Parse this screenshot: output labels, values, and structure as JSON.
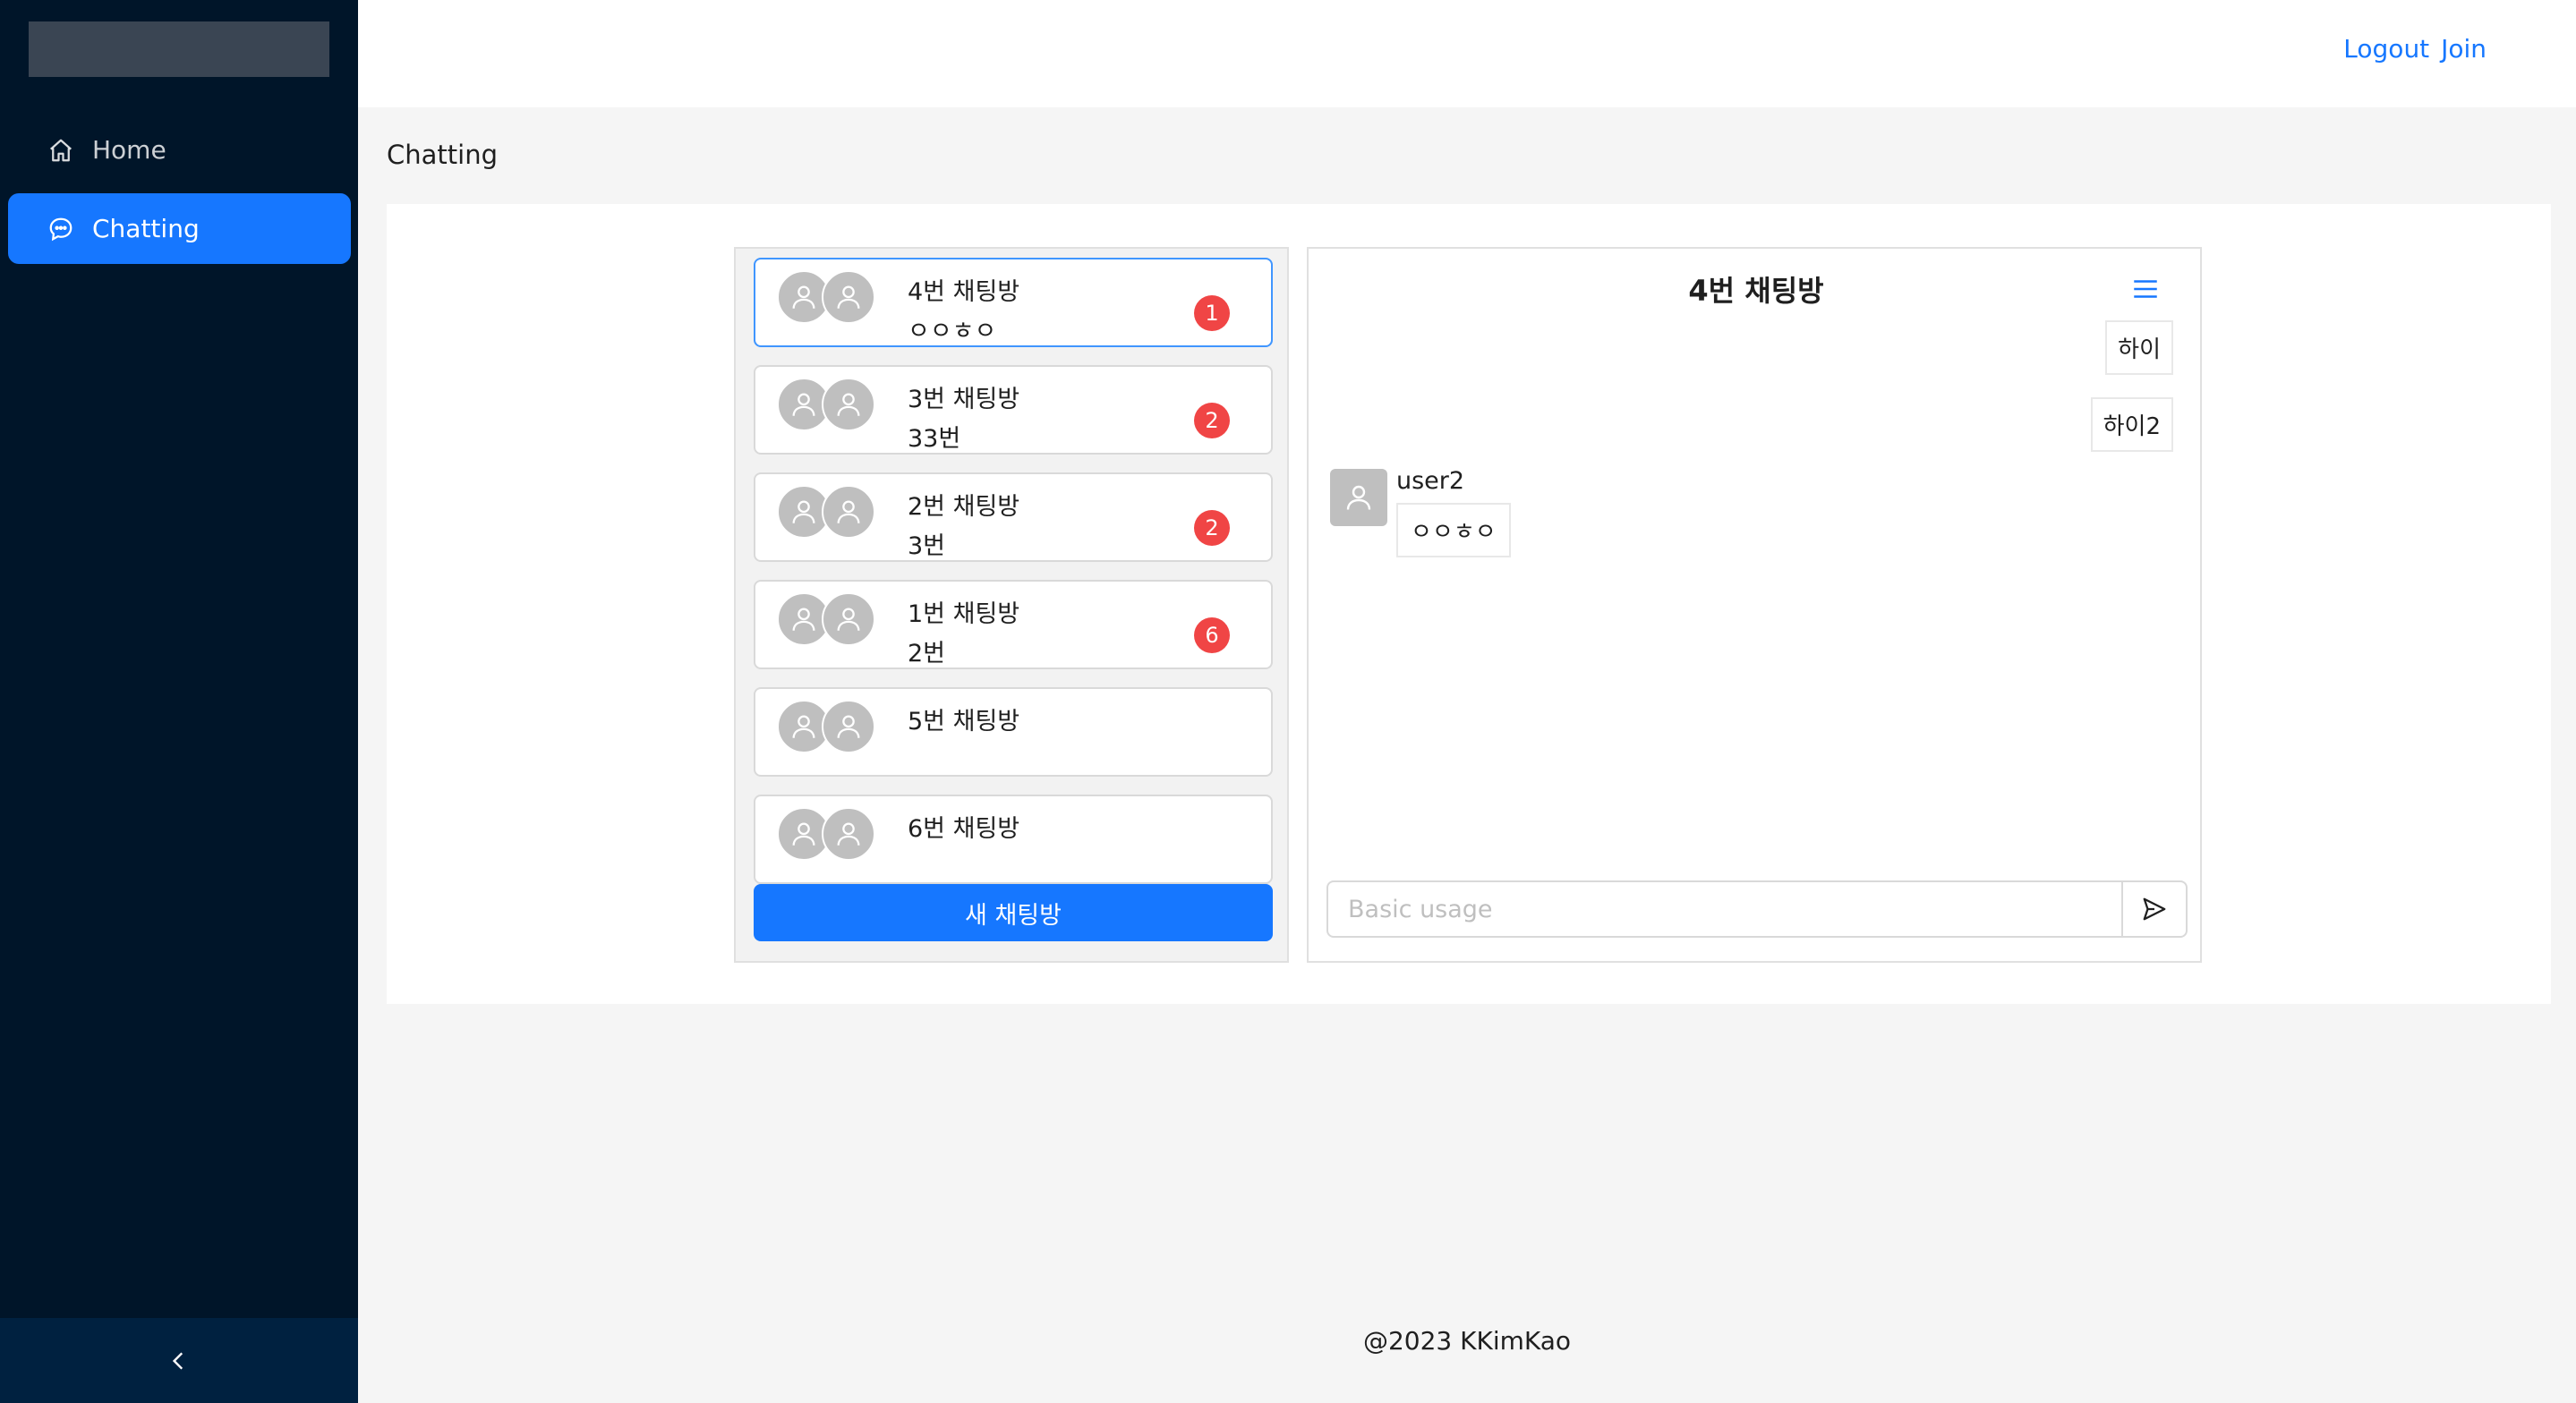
{
  "sidebar": {
    "items": [
      {
        "label": "Home",
        "icon": "home-icon"
      },
      {
        "label": "Chatting",
        "icon": "message-icon"
      }
    ],
    "collapse_icon": "chevron-left-icon"
  },
  "header": {
    "logout": "Logout",
    "join": "Join"
  },
  "breadcrumb": "Chatting",
  "rooms": [
    {
      "title": "4번 채팅방",
      "last": "ㅇㅇㅎㅇ",
      "unread": "1"
    },
    {
      "title": "3번 채팅방",
      "last": "33번",
      "unread": "2"
    },
    {
      "title": "2번 채팅방",
      "last": "3번",
      "unread": "2"
    },
    {
      "title": "1번 채팅방",
      "last": "2번",
      "unread": "6"
    },
    {
      "title": "5번 채팅방",
      "last": "",
      "unread": ""
    },
    {
      "title": "6번 채팅방",
      "last": "",
      "unread": ""
    }
  ],
  "new_room_label": "새 채팅방",
  "chat": {
    "title": "4번 채팅방",
    "my_messages": [
      "하이",
      "하이2"
    ],
    "other": {
      "user": "user2",
      "text": "ㅇㅇㅎㅇ"
    },
    "input_placeholder": "Basic usage"
  },
  "footer": "@2023 KKimKao",
  "colors": {
    "sidebar_bg": "#001529",
    "accent": "#1677ff",
    "badge": "#f04545"
  }
}
